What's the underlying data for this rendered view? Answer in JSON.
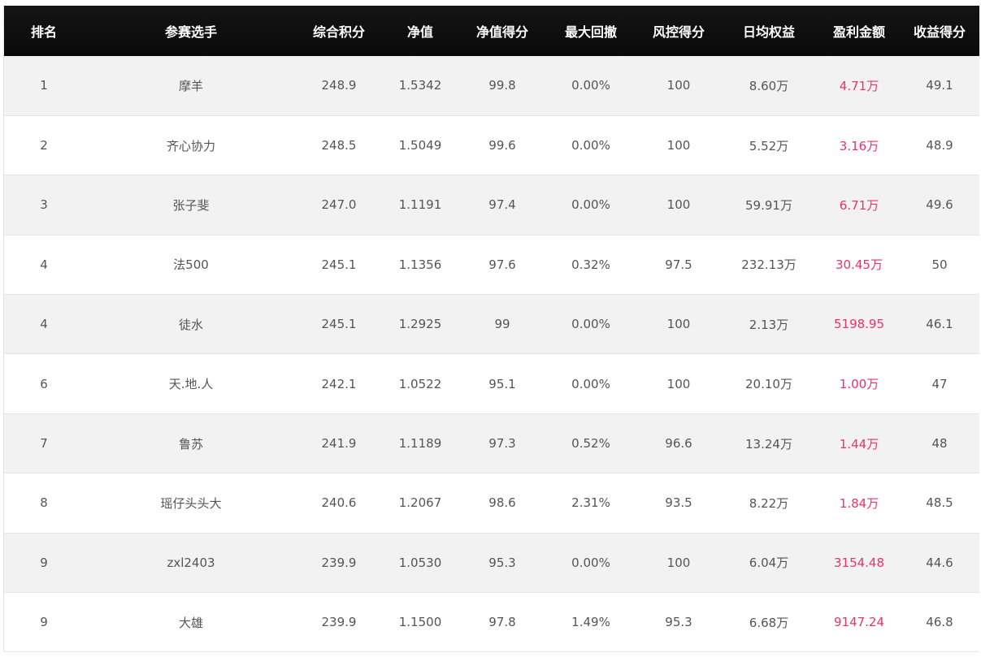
{
  "table": {
    "headers": [
      "排名",
      "参赛选手",
      "综合积分",
      "净值",
      "净值得分",
      "最大回撤",
      "风控得分",
      "日均权益",
      "盈利金额",
      "收益得分"
    ],
    "rows": [
      [
        "1",
        "摩羊",
        "248.9",
        "1.5342",
        "99.8",
        "0.00%",
        "100",
        "8.60万",
        "4.71万",
        "49.1"
      ],
      [
        "2",
        "齐心协力",
        "248.5",
        "1.5049",
        "99.6",
        "0.00%",
        "100",
        "5.52万",
        "3.16万",
        "48.9"
      ],
      [
        "3",
        "张子斐",
        "247.0",
        "1.1191",
        "97.4",
        "0.00%",
        "100",
        "59.91万",
        "6.71万",
        "49.6"
      ],
      [
        "4",
        "法500",
        "245.1",
        "1.1356",
        "97.6",
        "0.32%",
        "97.5",
        "232.13万",
        "30.45万",
        "50"
      ],
      [
        "4",
        "徒水",
        "245.1",
        "1.2925",
        "99",
        "0.00%",
        "100",
        "2.13万",
        "5198.95",
        "46.1"
      ],
      [
        "6",
        "天.地.人",
        "242.1",
        "1.0522",
        "95.1",
        "0.00%",
        "100",
        "20.10万",
        "1.00万",
        "47"
      ],
      [
        "7",
        "鲁苏",
        "241.9",
        "1.1189",
        "97.3",
        "0.52%",
        "96.6",
        "13.24万",
        "1.44万",
        "48"
      ],
      [
        "8",
        "瑶仔头头大",
        "240.6",
        "1.2067",
        "98.6",
        "2.31%",
        "93.5",
        "8.22万",
        "1.84万",
        "48.5"
      ],
      [
        "9",
        "zxl2403",
        "239.9",
        "1.0530",
        "95.3",
        "0.00%",
        "100",
        "6.04万",
        "3154.48",
        "44.6"
      ],
      [
        "9",
        "大雄",
        "239.9",
        "1.1500",
        "97.8",
        "1.49%",
        "95.3",
        "6.68万",
        "9147.24",
        "46.8"
      ]
    ]
  },
  "colors": {
    "header_bg": "#0a0a0a",
    "header_text": "#ffffff",
    "row_alt_bg": "#f2f2f2",
    "text": "#555555",
    "profit_text": "#e8336d"
  }
}
